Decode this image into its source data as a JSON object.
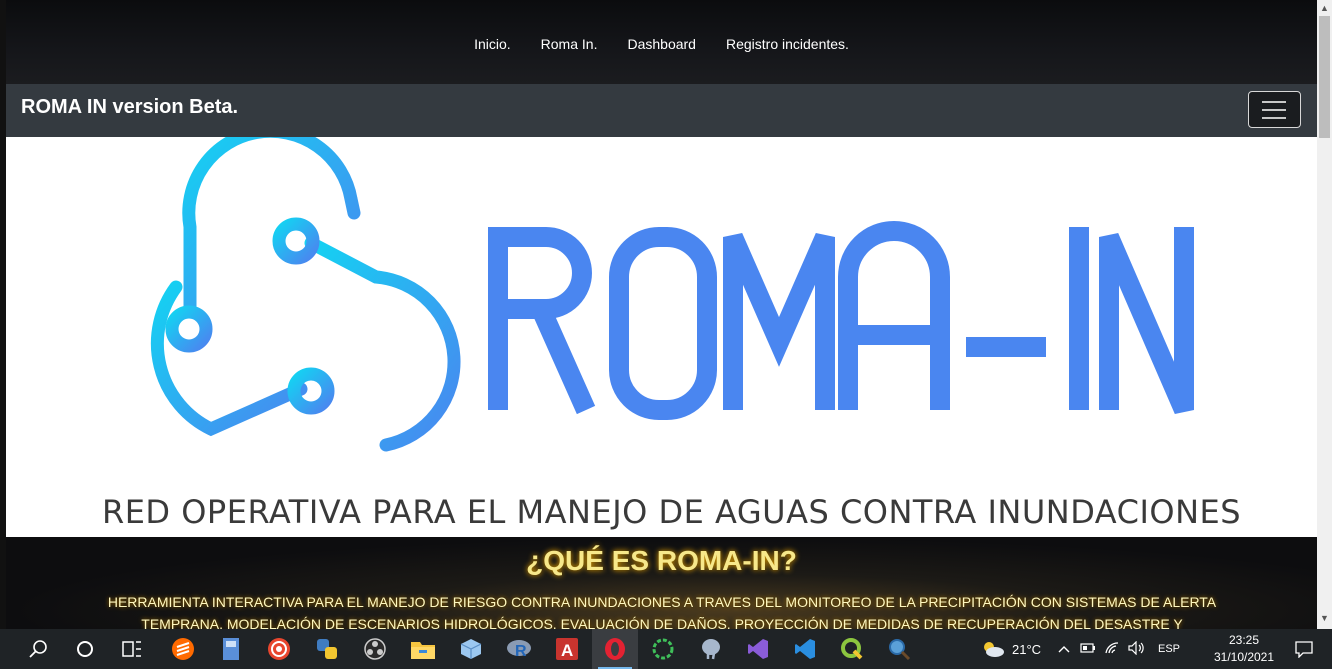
{
  "nav": {
    "items": [
      "Inicio.",
      "Roma In.",
      "Dashboard",
      "Registro incidentes."
    ]
  },
  "brandbar": {
    "brand": "ROMA IN version Beta.",
    "toggler_icon": "hamburger-icon"
  },
  "hero": {
    "logo_text": "ROMA-IN",
    "tagline": "RED OPERATIVA PARA EL MANEJO DE AGUAS CONTRA INUNDACIONES",
    "colors": {
      "logo_cyan": "#1ec8f0",
      "logo_blue": "#4a86f0"
    }
  },
  "about": {
    "title": "¿QUÉ ES ROMA-IN?",
    "line1": "HERRAMIENTA INTERACTIVA PARA EL MANEJO DE RIESGO CONTRA INUNDACIONES A TRAVES DEL MONITOREO DE LA PRECIPITACIÓN CON SISTEMAS DE ALERTA",
    "line2": "TEMPRANA, MODELACIÓN DE ESCENARIOS HIDROLÓGICOS, EVALUACIÓN DE DAÑOS, PROYECCIÓN DE MEDIDAS DE RECUPERACIÓN DEL DESASTRE Y MODELACIÓN"
  },
  "taskbar": {
    "apps": [
      "search-icon",
      "cortana-icon",
      "task-view-icon",
      "sublime-icon",
      "file-app-icon",
      "target-app-icon",
      "python-icon",
      "obs-icon",
      "file-explorer-icon",
      "box-app-icon",
      "r-icon",
      "access-icon",
      "opera-icon",
      "sync-app-icon",
      "postgres-icon",
      "visual-studio-icon",
      "vscode-icon",
      "qgis-icon",
      "search-app-icon"
    ],
    "weather": "21°C",
    "language": "ESP",
    "time": "23:25",
    "date": "31/10/2021"
  }
}
